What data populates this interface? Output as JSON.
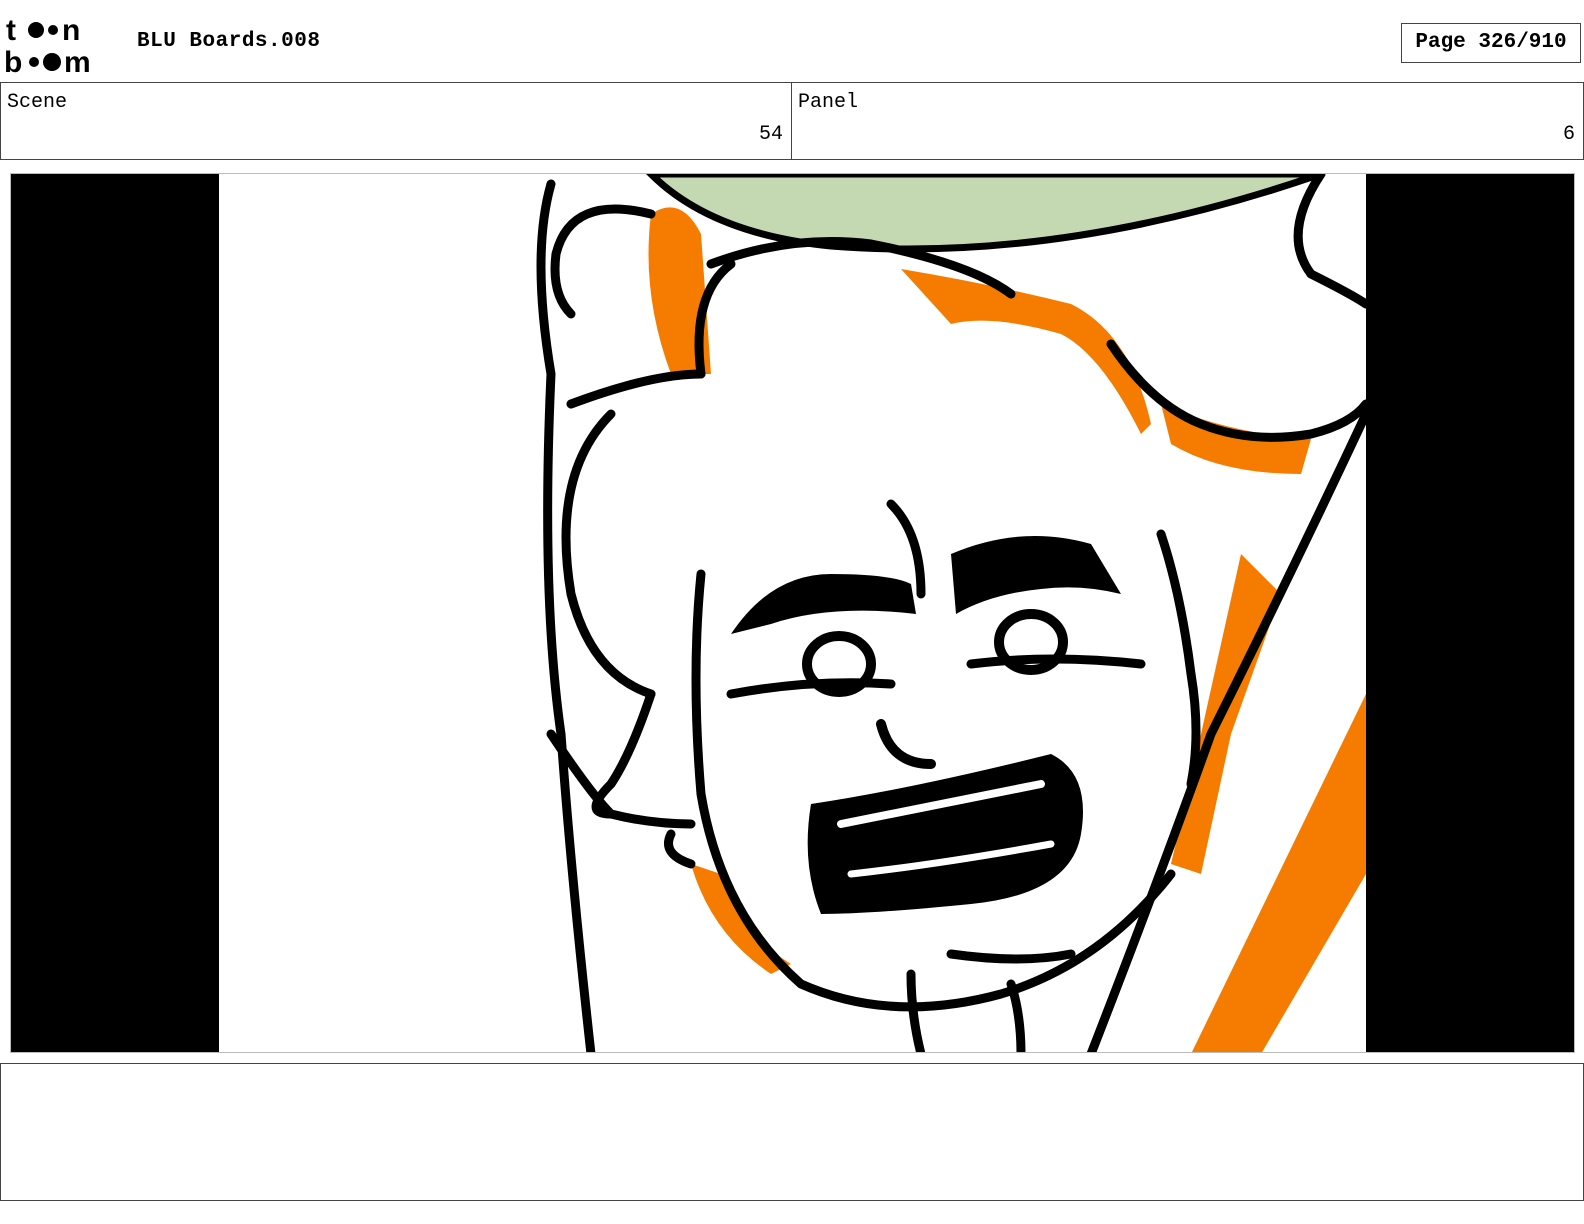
{
  "header": {
    "logo_text": "toonboom",
    "document_title": "BLU Boards.008",
    "page_label": "Page 326/910"
  },
  "info": {
    "scene_label": "Scene",
    "scene_value": "54",
    "panel_label": "Panel",
    "panel_value": "6"
  },
  "colors": {
    "accent_orange": "#f57c00",
    "hat_green": "#c4d8b2",
    "ink": "#000000"
  },
  "notes": {
    "text": ""
  }
}
